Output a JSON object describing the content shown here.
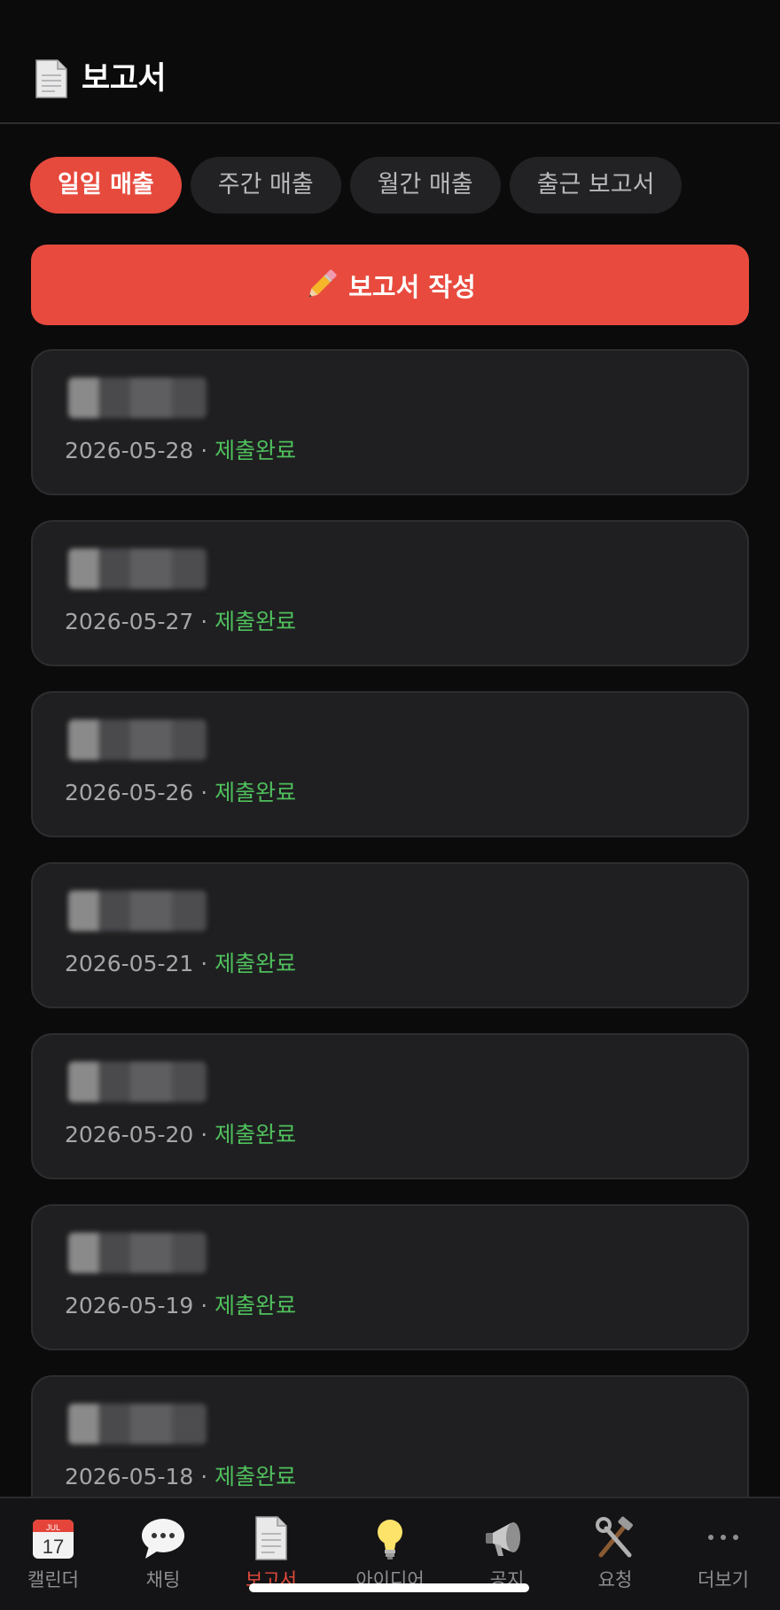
{
  "header": {
    "title": "보고서",
    "icon": "document-icon"
  },
  "tabs": [
    {
      "label": "일일 매출",
      "active": true
    },
    {
      "label": "주간 매출",
      "active": false
    },
    {
      "label": "월간 매출",
      "active": false
    },
    {
      "label": "출근 보고서",
      "active": false
    }
  ],
  "write_button": {
    "label": "보고서 작성",
    "icon": "pencil-icon"
  },
  "reports": [
    {
      "date": "2026-05-28",
      "separator": "·",
      "status": "제출완료"
    },
    {
      "date": "2026-05-27",
      "separator": "·",
      "status": "제출완료"
    },
    {
      "date": "2026-05-26",
      "separator": "·",
      "status": "제출완료"
    },
    {
      "date": "2026-05-21",
      "separator": "·",
      "status": "제출완료"
    },
    {
      "date": "2026-05-20",
      "separator": "·",
      "status": "제출완료"
    },
    {
      "date": "2026-05-19",
      "separator": "·",
      "status": "제출완료"
    },
    {
      "date": "2026-05-18",
      "separator": "·",
      "status": "제출완료"
    }
  ],
  "bottom_nav": [
    {
      "label": "캘린더",
      "icon": "calendar-icon",
      "calendar_month": "JUL",
      "calendar_day": "17"
    },
    {
      "label": "채팅",
      "icon": "chat-bubble-icon"
    },
    {
      "label": "보고서",
      "icon": "document-icon",
      "active": true
    },
    {
      "label": "아이디어",
      "icon": "lightbulb-icon"
    },
    {
      "label": "공지",
      "icon": "megaphone-icon"
    },
    {
      "label": "요청",
      "icon": "tools-icon"
    },
    {
      "label": "더보기",
      "icon": "more-dots-icon"
    }
  ],
  "colors": {
    "accent": "#e84b3e",
    "status_done": "#4fbf5c",
    "background": "#0b0b0c",
    "card": "#1f1f21"
  }
}
